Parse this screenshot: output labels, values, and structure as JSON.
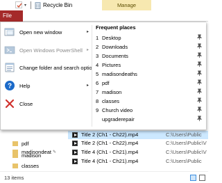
{
  "titlebar": {
    "title": "Recycle Bin",
    "context_tab": "Manage",
    "dropdown_glyph": "▾"
  },
  "ribbon": {
    "file_tab": "File"
  },
  "file_menu": {
    "items": [
      {
        "label": "Open new window",
        "icon": "new-window-icon",
        "has_submenu": true,
        "disabled": false
      },
      {
        "label": "Open Windows PowerShell",
        "icon": "powershell-icon",
        "has_submenu": true,
        "disabled": true
      },
      {
        "label": "Change folder and search options",
        "icon": "folder-options-icon",
        "has_submenu": false,
        "disabled": false
      },
      {
        "label": "Help",
        "icon": "help-icon",
        "has_submenu": true,
        "disabled": false
      },
      {
        "label": "Close",
        "icon": "close-icon",
        "has_submenu": false,
        "disabled": false
      }
    ],
    "frequent_places": {
      "header": "Frequent places",
      "items": [
        {
          "num": "1",
          "label": "Desktop"
        },
        {
          "num": "2",
          "label": "Downloads"
        },
        {
          "num": "3",
          "label": "Documents"
        },
        {
          "num": "4",
          "label": "Pictures"
        },
        {
          "num": "5",
          "label": "madisondeaths"
        },
        {
          "num": "6",
          "label": "pdf"
        },
        {
          "num": "7",
          "label": "madison"
        },
        {
          "num": "8",
          "label": "classes"
        },
        {
          "num": "9",
          "label": "Church video"
        },
        {
          "num": "",
          "label": "upgraderepair"
        }
      ]
    }
  },
  "left_pane": {
    "items": [
      {
        "label": "madisondeat"
      },
      {
        "label": "pdf"
      },
      {
        "label": "madison"
      },
      {
        "label": "classes"
      }
    ]
  },
  "file_list": {
    "rows": [
      {
        "name": "Title 2 (Ch1 - Ch22).mp4",
        "path": "C:\\Users\\Public"
      },
      {
        "name": "Title 2 (Ch1 - Ch22).mp4",
        "path": "C:\\Users\\Public\\V"
      },
      {
        "name": "Title 4 (Ch1 - Ch21).mp4",
        "path": "C:\\Users\\Public\\V"
      },
      {
        "name": "Title 4 (Ch1 - Ch21).mp4",
        "path": "C:\\Users\\Public"
      }
    ]
  },
  "statusbar": {
    "item_count": "13 items"
  },
  "colors": {
    "file_tab": "#a52a2a",
    "manage_tab": "#f7e8b0",
    "selection": "#cce8ff"
  }
}
